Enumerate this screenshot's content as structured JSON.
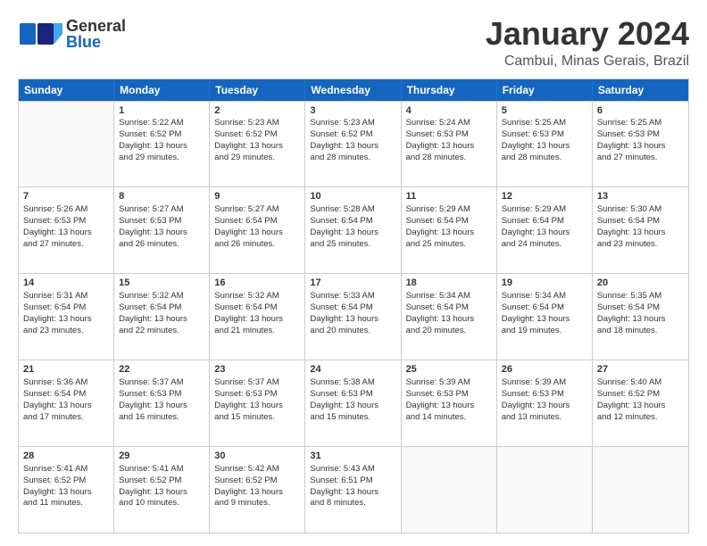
{
  "header": {
    "logo_general": "General",
    "logo_blue": "Blue",
    "main_title": "January 2024",
    "subtitle": "Cambui, Minas Gerais, Brazil"
  },
  "days_of_week": [
    "Sunday",
    "Monday",
    "Tuesday",
    "Wednesday",
    "Thursday",
    "Friday",
    "Saturday"
  ],
  "weeks": [
    [
      {
        "num": "",
        "text": ""
      },
      {
        "num": "1",
        "text": "Sunrise: 5:22 AM\nSunset: 6:52 PM\nDaylight: 13 hours\nand 29 minutes."
      },
      {
        "num": "2",
        "text": "Sunrise: 5:23 AM\nSunset: 6:52 PM\nDaylight: 13 hours\nand 29 minutes."
      },
      {
        "num": "3",
        "text": "Sunrise: 5:23 AM\nSunset: 6:52 PM\nDaylight: 13 hours\nand 28 minutes."
      },
      {
        "num": "4",
        "text": "Sunrise: 5:24 AM\nSunset: 6:53 PM\nDaylight: 13 hours\nand 28 minutes."
      },
      {
        "num": "5",
        "text": "Sunrise: 5:25 AM\nSunset: 6:53 PM\nDaylight: 13 hours\nand 28 minutes."
      },
      {
        "num": "6",
        "text": "Sunrise: 5:25 AM\nSunset: 6:53 PM\nDaylight: 13 hours\nand 27 minutes."
      }
    ],
    [
      {
        "num": "7",
        "text": "Sunrise: 5:26 AM\nSunset: 6:53 PM\nDaylight: 13 hours\nand 27 minutes."
      },
      {
        "num": "8",
        "text": "Sunrise: 5:27 AM\nSunset: 6:53 PM\nDaylight: 13 hours\nand 26 minutes."
      },
      {
        "num": "9",
        "text": "Sunrise: 5:27 AM\nSunset: 6:54 PM\nDaylight: 13 hours\nand 26 minutes."
      },
      {
        "num": "10",
        "text": "Sunrise: 5:28 AM\nSunset: 6:54 PM\nDaylight: 13 hours\nand 25 minutes."
      },
      {
        "num": "11",
        "text": "Sunrise: 5:29 AM\nSunset: 6:54 PM\nDaylight: 13 hours\nand 25 minutes."
      },
      {
        "num": "12",
        "text": "Sunrise: 5:29 AM\nSunset: 6:54 PM\nDaylight: 13 hours\nand 24 minutes."
      },
      {
        "num": "13",
        "text": "Sunrise: 5:30 AM\nSunset: 6:54 PM\nDaylight: 13 hours\nand 23 minutes."
      }
    ],
    [
      {
        "num": "14",
        "text": "Sunrise: 5:31 AM\nSunset: 6:54 PM\nDaylight: 13 hours\nand 23 minutes."
      },
      {
        "num": "15",
        "text": "Sunrise: 5:32 AM\nSunset: 6:54 PM\nDaylight: 13 hours\nand 22 minutes."
      },
      {
        "num": "16",
        "text": "Sunrise: 5:32 AM\nSunset: 6:54 PM\nDaylight: 13 hours\nand 21 minutes."
      },
      {
        "num": "17",
        "text": "Sunrise: 5:33 AM\nSunset: 6:54 PM\nDaylight: 13 hours\nand 20 minutes."
      },
      {
        "num": "18",
        "text": "Sunrise: 5:34 AM\nSunset: 6:54 PM\nDaylight: 13 hours\nand 20 minutes."
      },
      {
        "num": "19",
        "text": "Sunrise: 5:34 AM\nSunset: 6:54 PM\nDaylight: 13 hours\nand 19 minutes."
      },
      {
        "num": "20",
        "text": "Sunrise: 5:35 AM\nSunset: 6:54 PM\nDaylight: 13 hours\nand 18 minutes."
      }
    ],
    [
      {
        "num": "21",
        "text": "Sunrise: 5:36 AM\nSunset: 6:54 PM\nDaylight: 13 hours\nand 17 minutes."
      },
      {
        "num": "22",
        "text": "Sunrise: 5:37 AM\nSunset: 6:53 PM\nDaylight: 13 hours\nand 16 minutes."
      },
      {
        "num": "23",
        "text": "Sunrise: 5:37 AM\nSunset: 6:53 PM\nDaylight: 13 hours\nand 15 minutes."
      },
      {
        "num": "24",
        "text": "Sunrise: 5:38 AM\nSunset: 6:53 PM\nDaylight: 13 hours\nand 15 minutes."
      },
      {
        "num": "25",
        "text": "Sunrise: 5:39 AM\nSunset: 6:53 PM\nDaylight: 13 hours\nand 14 minutes."
      },
      {
        "num": "26",
        "text": "Sunrise: 5:39 AM\nSunset: 6:53 PM\nDaylight: 13 hours\nand 13 minutes."
      },
      {
        "num": "27",
        "text": "Sunrise: 5:40 AM\nSunset: 6:52 PM\nDaylight: 13 hours\nand 12 minutes."
      }
    ],
    [
      {
        "num": "28",
        "text": "Sunrise: 5:41 AM\nSunset: 6:52 PM\nDaylight: 13 hours\nand 11 minutes."
      },
      {
        "num": "29",
        "text": "Sunrise: 5:41 AM\nSunset: 6:52 PM\nDaylight: 13 hours\nand 10 minutes."
      },
      {
        "num": "30",
        "text": "Sunrise: 5:42 AM\nSunset: 6:52 PM\nDaylight: 13 hours\nand 9 minutes."
      },
      {
        "num": "31",
        "text": "Sunrise: 5:43 AM\nSunset: 6:51 PM\nDaylight: 13 hours\nand 8 minutes."
      },
      {
        "num": "",
        "text": ""
      },
      {
        "num": "",
        "text": ""
      },
      {
        "num": "",
        "text": ""
      }
    ]
  ]
}
